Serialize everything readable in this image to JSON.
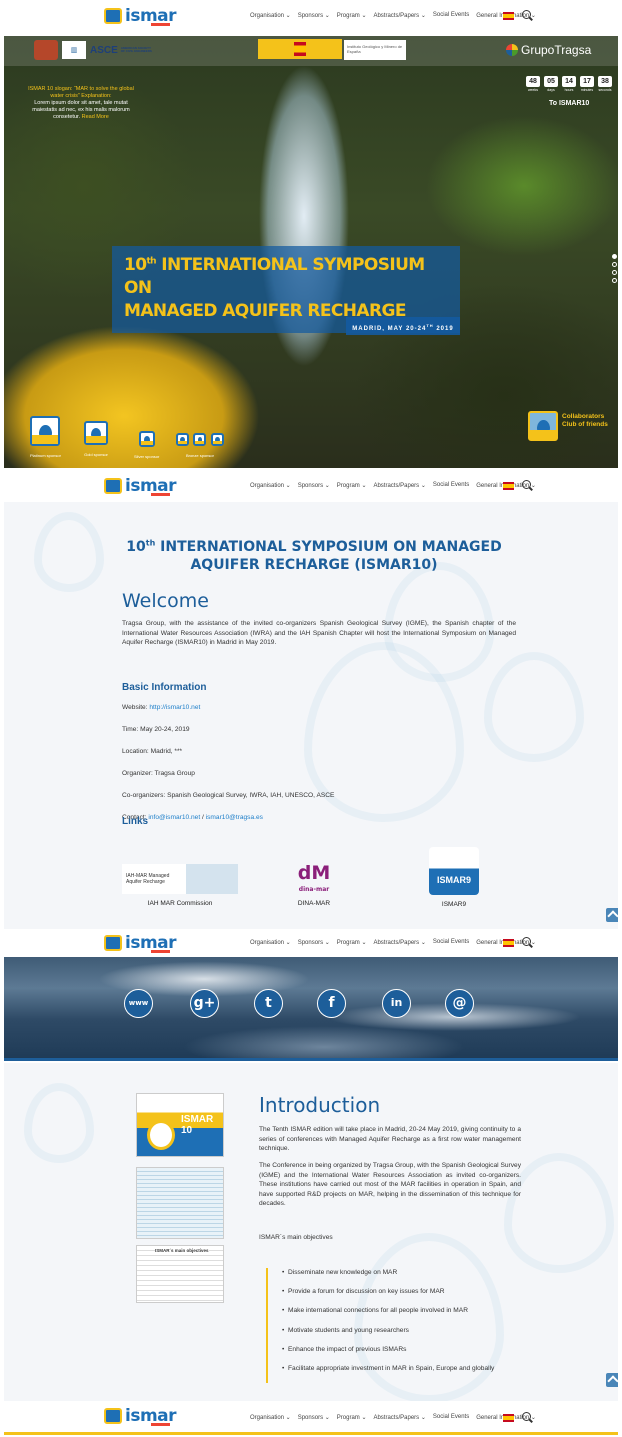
{
  "nav": {
    "logo_text": "ismar",
    "menu": [
      "Organisation ⌄",
      "Sponsors ⌄",
      "Program ⌄",
      "Abstracts/Papers ⌄",
      "Social Events",
      "General Information ⌄"
    ]
  },
  "hero": {
    "top_sponsors": [
      "ASCE",
      "AMERICAN SOCIETY OF CIVIL ENGINEERS",
      "Instituto Geológico y Minero de España",
      "GrupoTragsa"
    ],
    "slogan_1": "ISMAR 10 slogan: “MAR to solve the global water crisis” Explanation:",
    "slogan_2": "Lorem ipsum dolor sit amet, tale mutat maiestatis ad nec, ex his malis malorum consetetur.",
    "read_more": "Read More",
    "countdown": [
      {
        "num": "48",
        "label": "weeks"
      },
      {
        "num": "05",
        "label": "days"
      },
      {
        "num": "14",
        "label": "hours"
      },
      {
        "num": "17",
        "label": "minutes"
      },
      {
        "num": "38",
        "label": "seconds"
      }
    ],
    "to_ismar": "To ISMAR10",
    "title_line1_num": "10",
    "title_line1_sup": "th",
    "title_line1_rest": " INTERNATIONAL SYMPOSIUM ON",
    "title_line2": "MANAGED AQUIFER RECHARGE",
    "date": "MADRID, MAY 20-24",
    "date_sup": "TH",
    "date_year": " 2019",
    "sponsor_tiers": [
      "Platinum sponsor",
      "Gold sponsor",
      "Silver sponsor",
      "Bronze sponsor"
    ],
    "collab_1": "Collaborators",
    "collab_2": "Club of friends"
  },
  "welcome": {
    "heading_num": "10",
    "heading_sup": "th",
    "heading_rest": " INTERNATIONAL SYMPOSIUM ON MANAGED AQUIFER RECHARGE (ISMAR10)",
    "title": "Welcome",
    "paragraph": "Tragsa Group, with the assistance of the invited co-organizers Spanish Geological Survey (IGME), the Spanish chapter of the International Water Resources Association (IWRA) and the IAH Spanish Chapter will host the International Symposium on Managed Aquifer Recharge (ISMAR10) in Madrid in May 2019.",
    "basic_title": "Basic Information",
    "website_label": "Website: ",
    "website": "http://ismar10.net",
    "time": "Time: May 20-24, 2019",
    "location": "Location: Madrid, ***",
    "organizer": "Organizer: Tragsa Group",
    "coorganizers": "Co-organizers: Spanish Geological Survey, IWRA, IAH, UNESCO, ASCE",
    "contact_label": "Contact: ",
    "contact_1": "info@ismar10.net",
    "contact_sep": " / ",
    "contact_2": "ismar10@tragsa.es",
    "links_title": "Links",
    "links": [
      {
        "caption": "IAH MAR Commission",
        "logo": "IAH-MAR Managed Aquifer Recharge"
      },
      {
        "caption": "DINA-MAR",
        "logo": "dina-mar"
      },
      {
        "caption": "ISMAR9",
        "logo": "ISMAR9"
      }
    ]
  },
  "social": {
    "icons": [
      "www",
      "g+",
      "t",
      "f",
      "in",
      "@"
    ]
  },
  "intro": {
    "title": "Introduction",
    "p1": "The Tenth ISMAR edition will take place in Madrid, 20-24 May 2019, giving continuity to a series of conferences with Managed Aquifer Recharge as a first row water management technique.",
    "p2": "The Conference in being organized by Tragsa Group, with the Spanish Geological Survey (IGME) and the International Water Resources Association as invited co-organizers. These institutions have carried out most of the MAR facilities in operation in Spain, and have supported R&D projects on MAR, helping in the dissemination of this technique for decades.",
    "p3": "ISMAR´s main objectives",
    "objectives": [
      "Disseminate new knowledge on MAR",
      "Provide a forum for discussion on key issues for MAR",
      "Make international connections for all people involved in MAR",
      "Motivate students and young researchers",
      "Enhance the impact of previous ISMARs",
      "Facilitate appropriate investment in MAR in Spain, Europe and globally"
    ],
    "thumb1_title": "ISMAR 10",
    "thumb3_title": "ISMAR´s main objectives"
  },
  "colors": {
    "brand_blue": "#1d5e9a",
    "accent_yellow": "#f4c21a"
  }
}
